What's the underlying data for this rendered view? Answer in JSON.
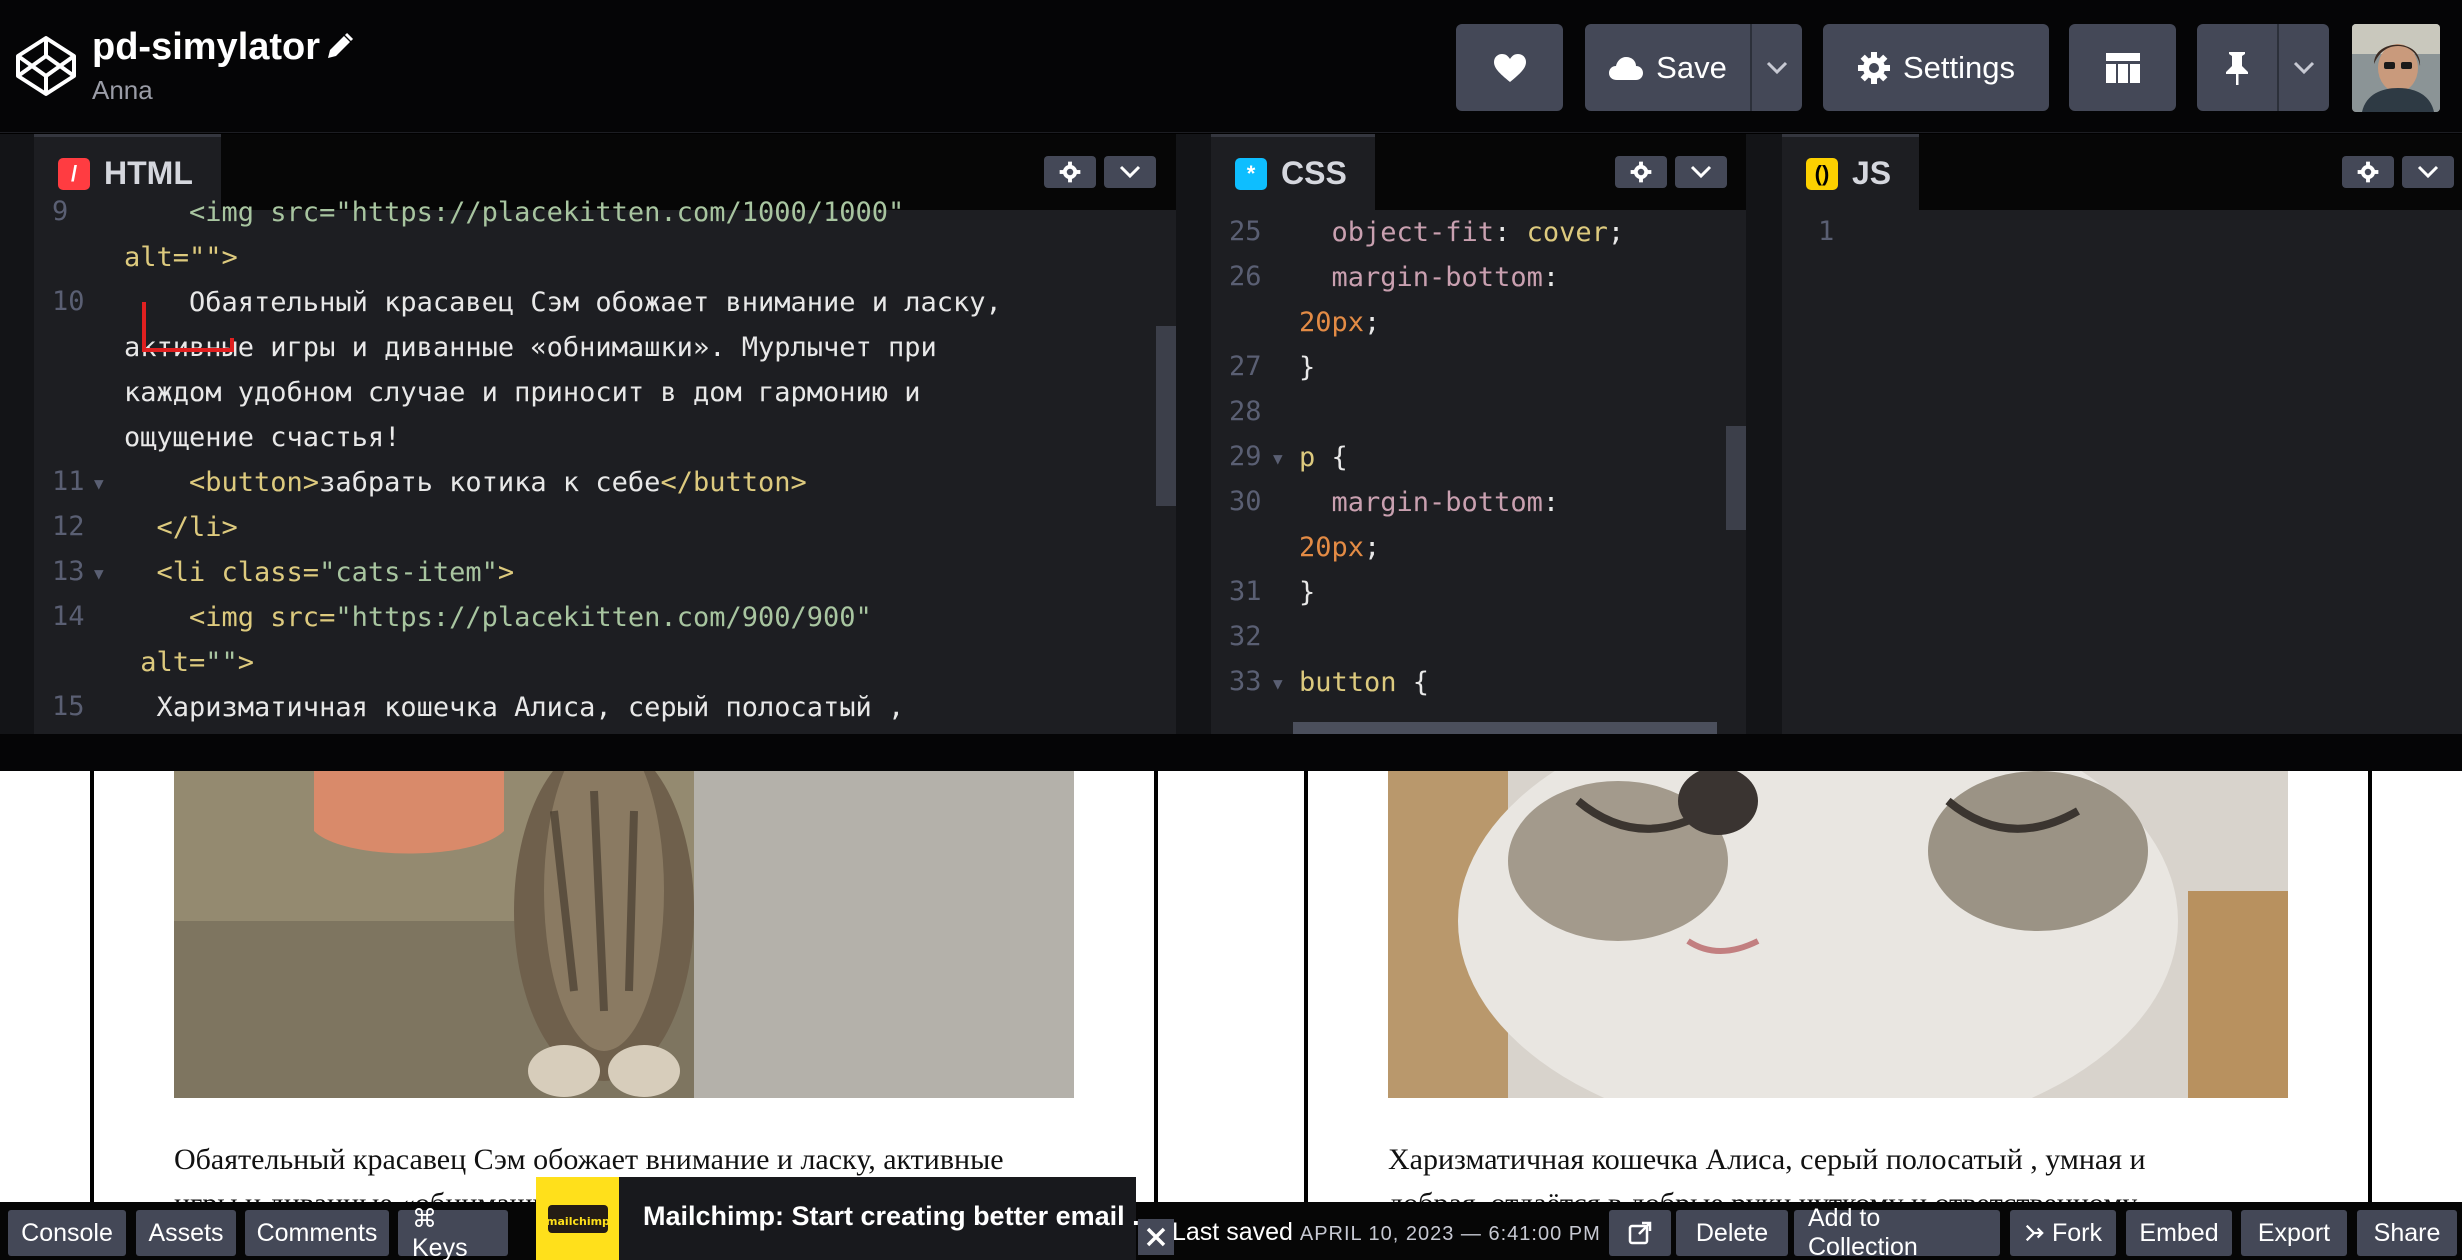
{
  "header": {
    "title": "pd-simylator",
    "author": "Anna",
    "like_icon": "heart-icon",
    "save_label": "Save",
    "settings_label": "Settings",
    "layout_icon": "layout-icon",
    "pin_icon": "pin-icon"
  },
  "editors": {
    "html": {
      "label": "HTML",
      "lines": [
        {
          "num": "9",
          "fold": false,
          "segments": [
            {
              "t": "    <img src=\"https://placekitten.com/1000/1000\"",
              "c": "t-str"
            }
          ]
        },
        {
          "num": "",
          "fold": false,
          "segments": [
            {
              "t": "alt=\"\">",
              "c": "t-attr"
            }
          ]
        },
        {
          "num": "10",
          "fold": false,
          "segments": [
            {
              "t": "    Обаятельный красавец Сэм обожает внимание и ласку,",
              "c": "t-txt"
            }
          ]
        },
        {
          "num": "",
          "fold": false,
          "segments": [
            {
              "t": "активные игры и диванные «обнимашки». Мурлычет при",
              "c": "t-txt"
            }
          ]
        },
        {
          "num": "",
          "fold": false,
          "segments": [
            {
              "t": "каждом удобном случае и приносит в дом гармонию и",
              "c": "t-txt"
            }
          ]
        },
        {
          "num": "",
          "fold": false,
          "segments": [
            {
              "t": "ощущение счастья!",
              "c": "t-txt"
            }
          ]
        },
        {
          "num": "11",
          "fold": true,
          "segments": [
            {
              "t": "    <button>",
              "c": "t-tag"
            },
            {
              "t": "забрать котика к себе",
              "c": "t-txt"
            },
            {
              "t": "</button>",
              "c": "t-tag"
            }
          ]
        },
        {
          "num": "12",
          "fold": false,
          "segments": [
            {
              "t": "  </li>",
              "c": "t-tag"
            }
          ]
        },
        {
          "num": "13",
          "fold": true,
          "segments": [
            {
              "t": "  <li class=",
              "c": "t-tag"
            },
            {
              "t": "\"cats-item\"",
              "c": "t-str"
            },
            {
              "t": ">",
              "c": "t-tag"
            }
          ]
        },
        {
          "num": "14",
          "fold": false,
          "segments": [
            {
              "t": "    <img src=",
              "c": "t-tag"
            },
            {
              "t": "\"https://placekitten.com/900/900\"",
              "c": "t-str"
            }
          ]
        },
        {
          "num": "",
          "fold": false,
          "segments": [
            {
              "t": " alt=",
              "c": "t-attr"
            },
            {
              "t": "\"\"",
              "c": "t-str"
            },
            {
              "t": ">",
              "c": "t-tag"
            }
          ]
        },
        {
          "num": "15",
          "fold": false,
          "segments": [
            {
              "t": "  Харизматичная кошечка Алиса, серый полосатый ,",
              "c": "t-txt"
            }
          ]
        }
      ]
    },
    "css": {
      "label": "CSS",
      "lines": [
        {
          "num": "25",
          "fold": false,
          "segments": [
            {
              "t": "  object-fit",
              "c": "t-prop"
            },
            {
              "t": ": ",
              "c": "t-punct"
            },
            {
              "t": "cover",
              "c": "t-val"
            },
            {
              "t": ";",
              "c": "t-punct"
            }
          ]
        },
        {
          "num": "26",
          "fold": false,
          "segments": [
            {
              "t": "  margin-bottom",
              "c": "t-prop"
            },
            {
              "t": ":",
              "c": "t-punct"
            }
          ]
        },
        {
          "num": "",
          "fold": false,
          "segments": [
            {
              "t": "20px",
              "c": "t-num"
            },
            {
              "t": ";",
              "c": "t-punct"
            }
          ]
        },
        {
          "num": "27",
          "fold": false,
          "segments": [
            {
              "t": "}",
              "c": "t-punct"
            }
          ]
        },
        {
          "num": "28",
          "fold": false,
          "segments": [
            {
              "t": "",
              "c": "t-punct"
            }
          ]
        },
        {
          "num": "29",
          "fold": true,
          "segments": [
            {
              "t": "p",
              "c": "t-sel"
            },
            {
              "t": " {",
              "c": "t-punct"
            }
          ]
        },
        {
          "num": "30",
          "fold": false,
          "segments": [
            {
              "t": "  margin-bottom",
              "c": "t-prop"
            },
            {
              "t": ":",
              "c": "t-punct"
            }
          ]
        },
        {
          "num": "",
          "fold": false,
          "segments": [
            {
              "t": "20px",
              "c": "t-num"
            },
            {
              "t": ";",
              "c": "t-punct"
            }
          ]
        },
        {
          "num": "31",
          "fold": false,
          "segments": [
            {
              "t": "}",
              "c": "t-punct"
            }
          ]
        },
        {
          "num": "32",
          "fold": false,
          "segments": [
            {
              "t": "",
              "c": "t-punct"
            }
          ]
        },
        {
          "num": "33",
          "fold": true,
          "segments": [
            {
              "t": "button",
              "c": "t-sel"
            },
            {
              "t": " {",
              "c": "t-punct"
            }
          ]
        }
      ]
    },
    "js": {
      "label": "JS",
      "lines": [
        {
          "num": "1",
          "fold": false,
          "segments": [
            {
              "t": "",
              "c": "t-txt"
            }
          ]
        }
      ]
    }
  },
  "preview": {
    "card1_text_line1": "Обаятельный красавец Сэм обожает внимание и ласку, активные",
    "card1_text_line2": "игры и диванные «обнимашки». Мурлычет при",
    "card2_text_line1": "Харизматичная кошечка Алиса, серый полосатый , умная и",
    "card2_text_line2": "добрая, отдаётся в добрые руки чуткому и ответственному"
  },
  "footer": {
    "console": "Console",
    "assets": "Assets",
    "comments": "Comments",
    "keys": "⌘ Keys",
    "ad_brand": "mailchimp",
    "ad_text": "Mailchimp: Start creating better email ...",
    "last_saved_label": "Last saved",
    "last_saved_time": "APRIL 10, 2023 — 6:41:00 PM",
    "delete": "Delete",
    "add_to_collection": "Add to Collection",
    "fork": "Fork",
    "embed": "Embed",
    "export": "Export",
    "share": "Share"
  },
  "colors": {
    "html_badge": "#ff3c41",
    "css_badge": "#0ebeff",
    "js_badge": "#fcd000",
    "button_bg": "#444857"
  }
}
